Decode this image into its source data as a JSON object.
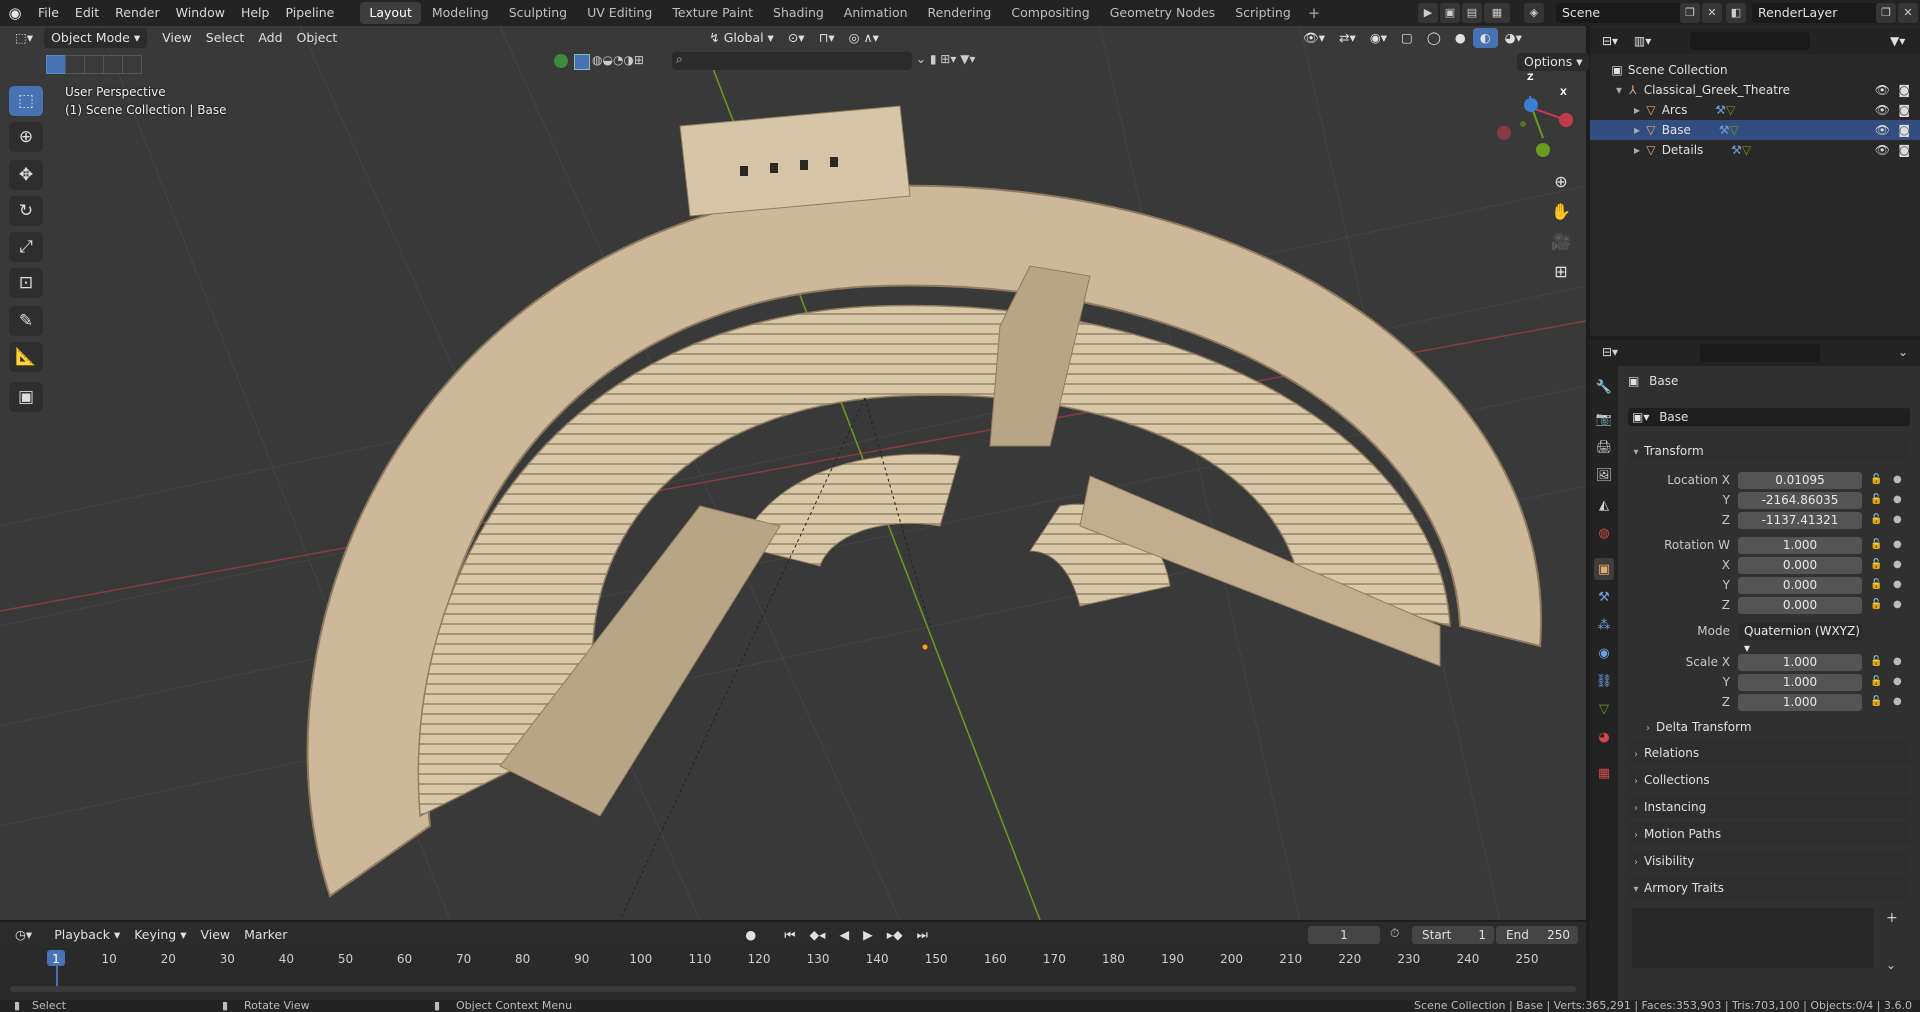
{
  "app": {
    "menus": [
      "File",
      "Edit",
      "Render",
      "Window",
      "Help",
      "Pipeline"
    ],
    "workspaces": [
      "Layout",
      "Modeling",
      "Sculpting",
      "UV Editing",
      "Texture Paint",
      "Shading",
      "Animation",
      "Rendering",
      "Compositing",
      "Geometry Nodes",
      "Scripting"
    ],
    "active_workspace": "Layout",
    "scene_name": "Scene",
    "view_layer": "RenderLayer"
  },
  "viewport": {
    "mode": "Object Mode",
    "menus": [
      "View",
      "Select",
      "Add",
      "Object"
    ],
    "transform_orientation": "Global",
    "options_label": "Options",
    "perspective_label": "User Perspective",
    "collection_label": "(1) Scene Collection | Base",
    "gizmo_axes": {
      "x": "X",
      "y": "Y",
      "z": "Z"
    },
    "colors": {
      "x_axis": "#c33a4a",
      "y_axis": "#6b9b1e",
      "z_axis": "#3b7fd4",
      "stone": "#d6c5a6",
      "background": "#393939"
    }
  },
  "outliner": {
    "root": "Scene Collection",
    "collection": "Classical_Greek_Theatre",
    "items": [
      "Arcs",
      "Base",
      "Details"
    ]
  },
  "properties": {
    "object_name": "Base",
    "data_name": "Base",
    "transform_header": "Transform",
    "location_label": "Location X",
    "location": {
      "x": "0.01095",
      "y": "-2164.86035",
      "z": "-1137.41321"
    },
    "rotation_label": "Rotation W",
    "rotation": {
      "w": "1.000",
      "x": "0.000",
      "y": "0.000",
      "z": "0.000"
    },
    "mode_label": "Mode",
    "mode_value": "Quaternion (WXYZ)",
    "scale_label": "Scale X",
    "scale": {
      "x": "1.000",
      "y": "1.000",
      "z": "1.000"
    },
    "axis_labels": {
      "x": "X",
      "y": "Y",
      "z": "Z"
    },
    "sections": [
      "Delta Transform",
      "Relations",
      "Collections",
      "Instancing",
      "Motion Paths",
      "Visibility",
      "Armory Traits"
    ]
  },
  "timeline": {
    "menus": [
      "Playback",
      "Keying",
      "View",
      "Marker"
    ],
    "current_frame": "1",
    "start_label": "Start",
    "start_value": "1",
    "end_label": "End",
    "end_value": "250",
    "ticks": [
      "1",
      "10",
      "20",
      "30",
      "40",
      "50",
      "60",
      "70",
      "80",
      "90",
      "100",
      "110",
      "120",
      "130",
      "140",
      "150",
      "160",
      "170",
      "180",
      "190",
      "200",
      "210",
      "220",
      "230",
      "240",
      "250"
    ]
  },
  "statusbar": {
    "left": "Select",
    "middle": "Rotate View",
    "right_hint": "Object Context Menu",
    "stats": "Scene Collection | Base | Verts:365,291 | Faces:353,903 | Tris:703,100 | Objects:0/4 | 3.6.0"
  }
}
